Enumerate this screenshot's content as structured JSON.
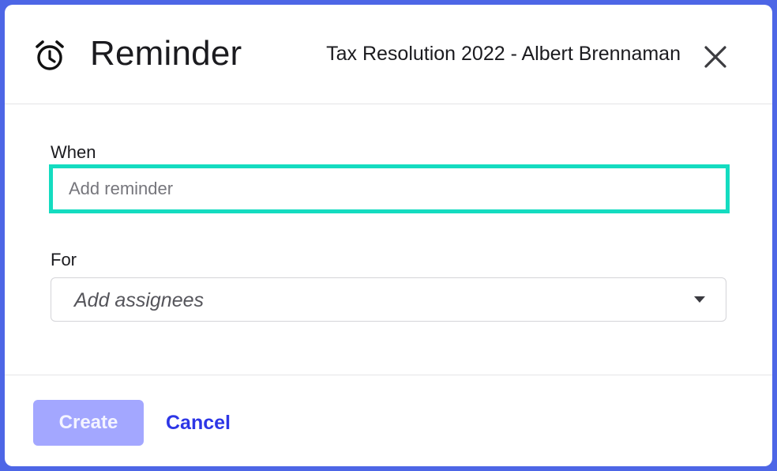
{
  "dialog": {
    "title": "Reminder",
    "subtitle": "Tax Resolution 2022 - Albert Brennaman",
    "icon": "alarm-clock-icon",
    "close_icon": "close-icon"
  },
  "form": {
    "when": {
      "label": "When",
      "placeholder": "Add reminder",
      "value": "",
      "focus_color": "#14dcc0"
    },
    "for": {
      "label": "For",
      "placeholder": "Add assignees",
      "dropdown_icon": "caret-down-icon"
    }
  },
  "footer": {
    "create_label": "Create",
    "cancel_label": "Cancel",
    "create_color": "#a3a7ff",
    "cancel_color": "#2d36e6"
  },
  "colors": {
    "backdrop": "#4d66e6",
    "text": "#1b1b1f"
  }
}
